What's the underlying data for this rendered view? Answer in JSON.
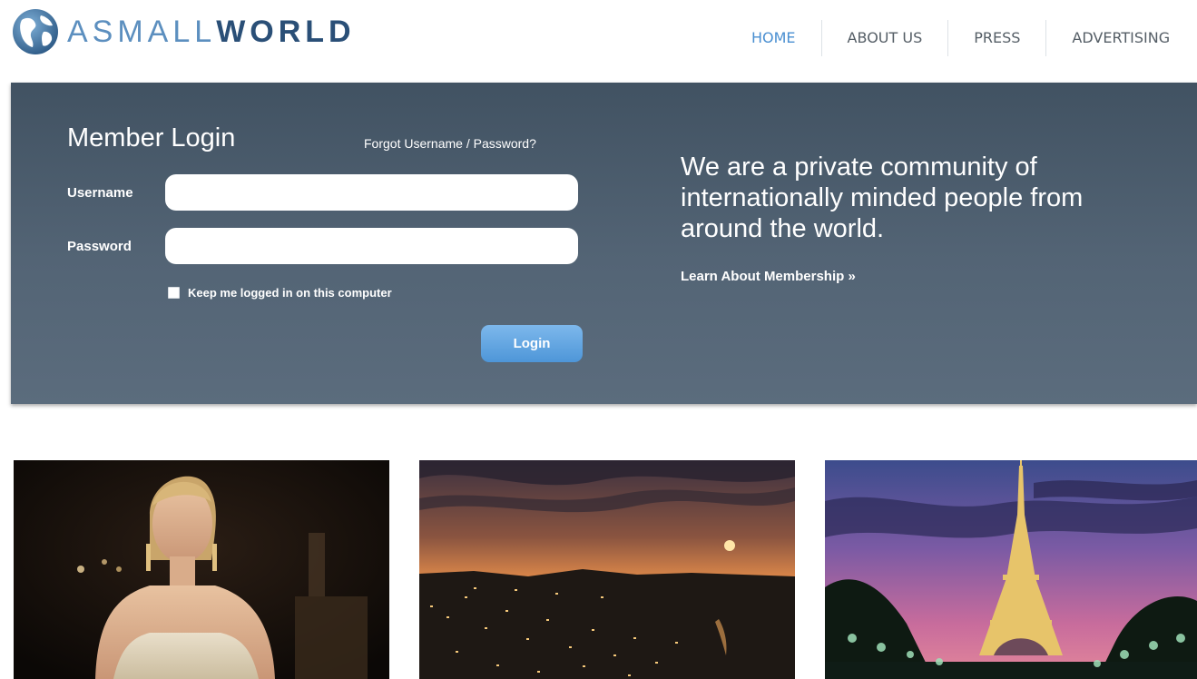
{
  "logo": {
    "text_light": "ASMALL",
    "text_bold": "WORLD",
    "icon": "globe-icon",
    "colors": {
      "light": "#5c8fbf",
      "bold": "#2a4f77"
    }
  },
  "nav": {
    "items": [
      {
        "label": "HOME",
        "active": true
      },
      {
        "label": "ABOUT US",
        "active": false
      },
      {
        "label": "PRESS",
        "active": false
      },
      {
        "label": "ADVERTISING",
        "active": false
      }
    ],
    "active_color": "#4a8fd1"
  },
  "login": {
    "title": "Member Login",
    "forgot_link": "Forgot Username / Password?",
    "username_label": "Username",
    "username_value": "",
    "password_label": "Password",
    "password_value": "",
    "remember_label": "Keep me logged in on this computer",
    "remember_checked": false,
    "submit_label": "Login",
    "panel_color": "#4f6072",
    "button_color": "#5a9fde"
  },
  "promo": {
    "tagline": "We are a private community of internationally minded people from around the world.",
    "learn_more": "Learn About Membership »"
  },
  "gallery": {
    "photos": [
      {
        "subject": "woman-portrait-photo"
      },
      {
        "subject": "coastal-city-sunset-photo"
      },
      {
        "subject": "eiffel-tower-dusk-photo"
      }
    ]
  }
}
